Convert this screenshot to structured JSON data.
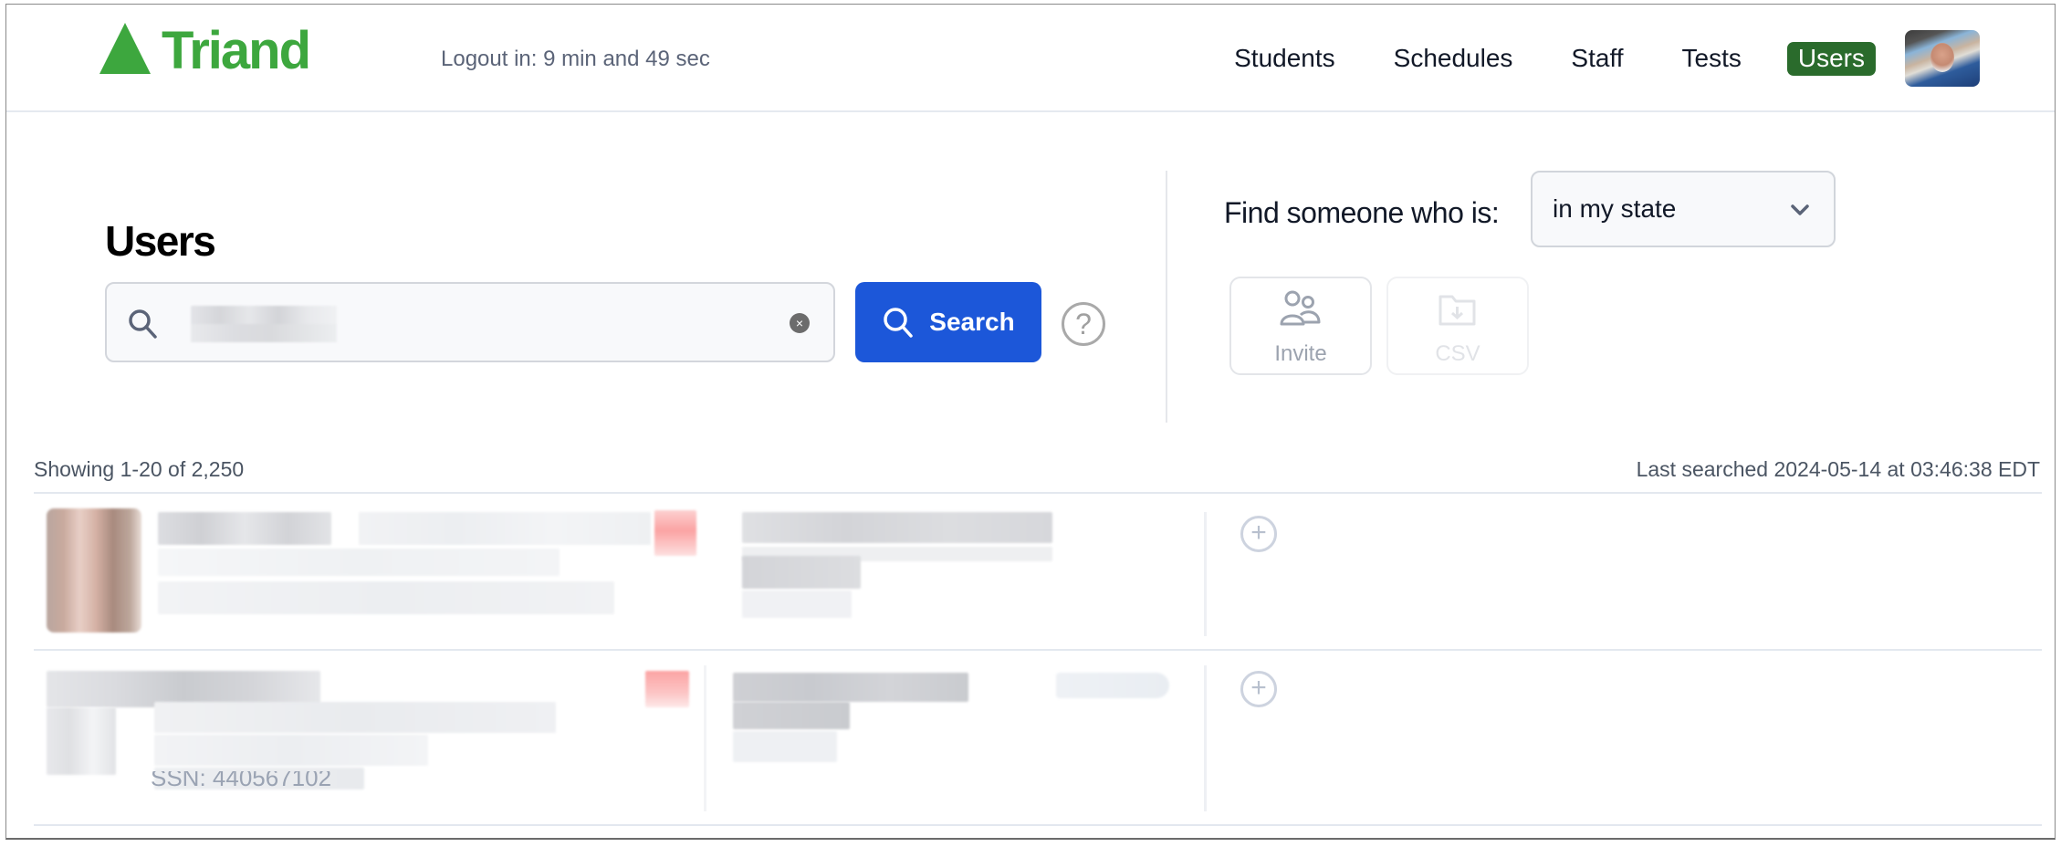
{
  "header": {
    "brand": "Triand",
    "brand_color": "#3da73e",
    "logout_timer": "Logout in: 9 min and 49 sec",
    "nav": [
      {
        "label": "Students",
        "active": false
      },
      {
        "label": "Schedules",
        "active": false
      },
      {
        "label": "Staff",
        "active": false
      },
      {
        "label": "Tests",
        "active": false
      },
      {
        "label": "Users",
        "active": true
      }
    ],
    "active_nav_color": "#2a6b2c",
    "avatar_icon": "user-avatar"
  },
  "search": {
    "title": "Users",
    "input_value": "[redacted]",
    "search_icon": "search-icon",
    "clear_icon": "×",
    "button_label": "Search",
    "button_color": "#1c57d9",
    "help_icon": "?"
  },
  "filter": {
    "label": "Find someone who is:",
    "selected_scope": "in my state",
    "actions": [
      {
        "label": "Invite",
        "icon": "users-icon",
        "enabled": true
      },
      {
        "label": "CSV",
        "icon": "folder-download-icon",
        "enabled": false
      }
    ]
  },
  "results": {
    "showing": "Showing 1-20 of 2,250",
    "last_searched": "Last searched 2024-05-14 at 03:46:38 EDT",
    "rows": [
      {
        "name": "[redacted]",
        "details": "[redacted]",
        "add_icon": "+"
      },
      {
        "name": "[redacted]",
        "details": "[redacted]",
        "ssn_fragment": "SSN: 440567102",
        "add_icon": "+"
      }
    ]
  }
}
